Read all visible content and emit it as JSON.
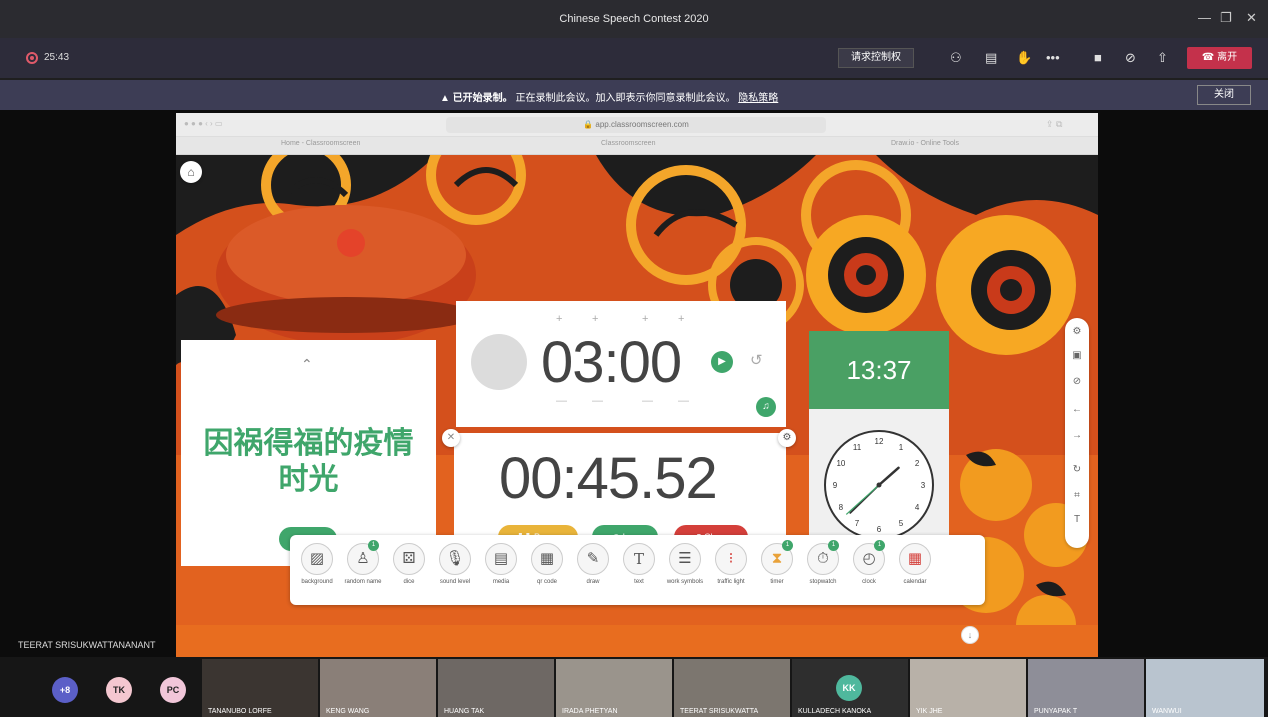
{
  "window": {
    "title": "Chinese Speech Contest 2020"
  },
  "meeting": {
    "recording_time": "25:43",
    "request_control": "请求控制权",
    "leave": "离开"
  },
  "banner": {
    "message_prefix": "已开始录制。",
    "message_body": "正在录制此会议。加入即表示你同意录制此会议。",
    "privacy_link": "隐私策略",
    "close": "关闭"
  },
  "browser": {
    "url": "app.classroomscreen.com",
    "tabs": [
      "Home - Classroomscreen",
      "Classroomscreen",
      "Draw.io - Online Tools"
    ]
  },
  "name_widget": {
    "chosen": "因祸得福的疫情时光",
    "choose_label": "Choose"
  },
  "timer": {
    "display": "03:00"
  },
  "stopwatch": {
    "display": "00:45.52",
    "pause_label": "Pause",
    "lap_label": "Lap",
    "clear_label": "Clear"
  },
  "clock": {
    "digital": "13:37",
    "hour": 1,
    "minute": 37,
    "second": 38
  },
  "toolbar": {
    "items": [
      {
        "label": "background",
        "icon": "image-icon",
        "badge": ""
      },
      {
        "label": "random name",
        "icon": "random-name-icon",
        "badge": "1"
      },
      {
        "label": "dice",
        "icon": "dice-icon",
        "badge": ""
      },
      {
        "label": "sound level",
        "icon": "microphone-icon",
        "badge": ""
      },
      {
        "label": "media",
        "icon": "media-icon",
        "badge": ""
      },
      {
        "label": "qr code",
        "icon": "qr-code-icon",
        "badge": ""
      },
      {
        "label": "draw",
        "icon": "pencil-icon",
        "badge": ""
      },
      {
        "label": "text",
        "icon": "text-icon",
        "badge": ""
      },
      {
        "label": "work symbols",
        "icon": "work-symbols-icon",
        "badge": ""
      },
      {
        "label": "traffic light",
        "icon": "traffic-light-icon",
        "badge": ""
      },
      {
        "label": "timer",
        "icon": "hourglass-icon",
        "badge": "1"
      },
      {
        "label": "stopwatch",
        "icon": "stopwatch-icon",
        "badge": "1"
      },
      {
        "label": "clock",
        "icon": "clock-icon",
        "badge": "1"
      },
      {
        "label": "calendar",
        "icon": "calendar-icon",
        "badge": ""
      }
    ]
  },
  "presenter": "TEERAT SRISUKWATTANANANT",
  "participants": {
    "overflow": "+8",
    "initials": [
      "TK",
      "PC",
      "KK"
    ],
    "video_names": [
      "TANANUBO LORFE",
      "KENG WANG",
      "HUANG TAK",
      "IRADA PHETYAN",
      "TEERAT SRISUKWATTA",
      "KULLADECH KANOKA",
      "YIK JHE",
      "PUNYAPAK T",
      "WANWUI"
    ]
  },
  "colors": {
    "accent_green": "#3fa66b",
    "leave_red": "#c4314b",
    "pause_yellow": "#e9b43a",
    "clear_red": "#d43f3a"
  }
}
